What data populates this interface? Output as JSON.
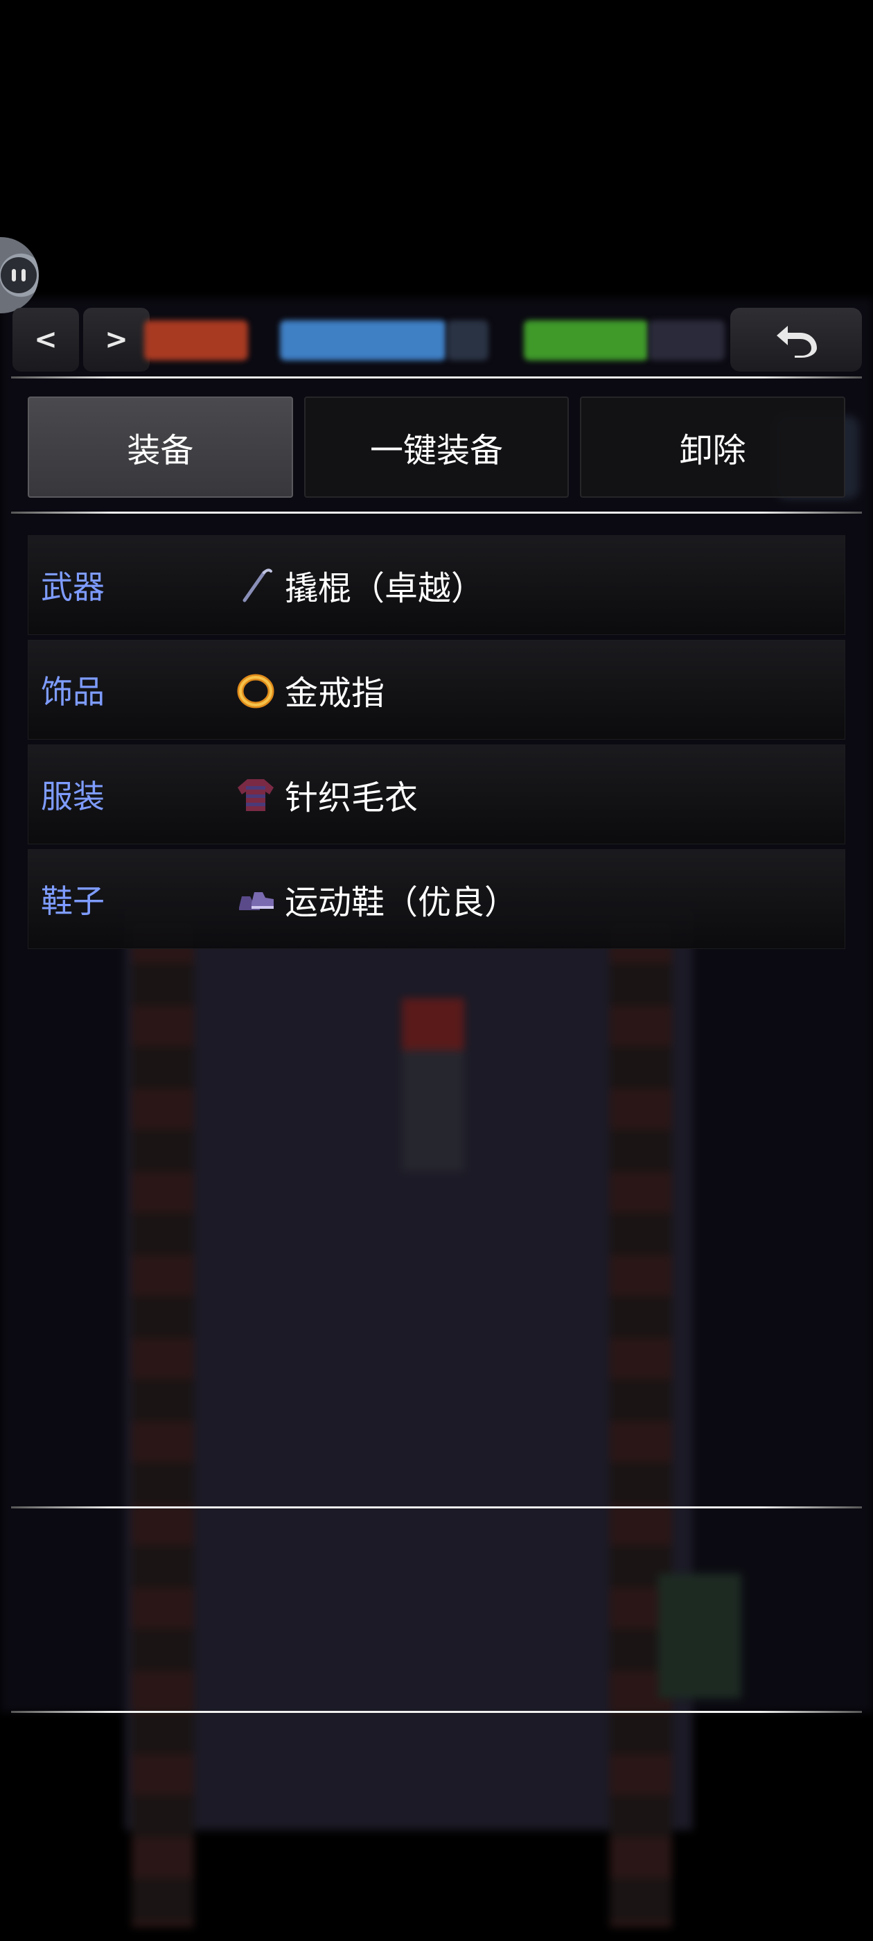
{
  "topbar": {
    "prev_label": "<",
    "next_label": ">"
  },
  "tabs": [
    {
      "label": "装备",
      "active": true
    },
    {
      "label": "一键装备",
      "active": false
    },
    {
      "label": "卸除",
      "active": false
    }
  ],
  "equipment": [
    {
      "slot": "武器",
      "item": "撬棍（卓越）",
      "icon": "crowbar-icon"
    },
    {
      "slot": "饰品",
      "item": "金戒指",
      "icon": "gold-ring-icon"
    },
    {
      "slot": "服装",
      "item": "针织毛衣",
      "icon": "sweater-icon"
    },
    {
      "slot": "鞋子",
      "item": "运动鞋（优良）",
      "icon": "sneakers-icon"
    }
  ],
  "colors": {
    "slot_label": "#7e9cff",
    "item_text": "#ffffff",
    "active_tab": "#404044"
  }
}
